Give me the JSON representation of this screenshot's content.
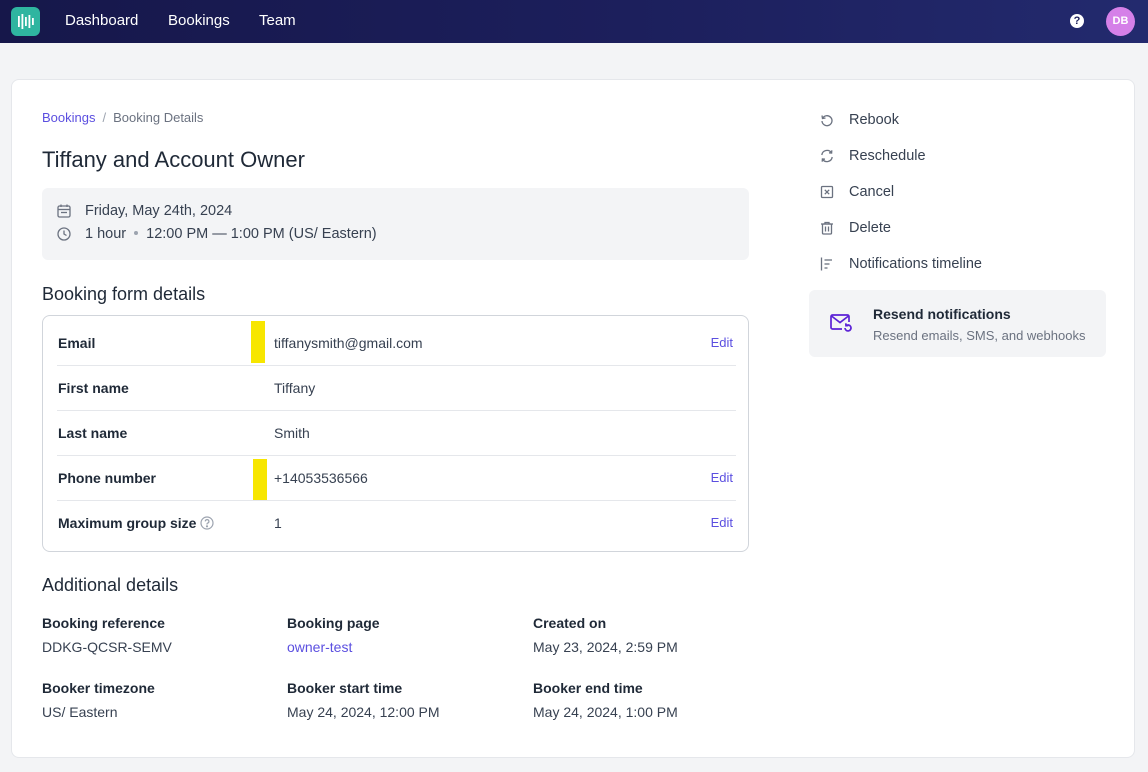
{
  "nav": {
    "items": [
      "Dashboard",
      "Bookings",
      "Team"
    ],
    "help_label": "?",
    "avatar_initials": "DB",
    "brand_color": "#2fb5a0"
  },
  "breadcrumb": {
    "parent": "Bookings",
    "separator": "/",
    "current": "Booking Details"
  },
  "booking": {
    "title": "Tiffany and Account Owner",
    "date": "Friday, May 24th, 2024",
    "duration": "1 hour",
    "time_range": "12:00 PM — 1:00 PM (US/ Eastern)"
  },
  "form_details": {
    "heading": "Booking form details",
    "edit_label": "Edit",
    "rows": [
      {
        "label": "Email",
        "value": "tiffanysmith@gmail.com",
        "editable": true
      },
      {
        "label": "First name",
        "value": "Tiffany",
        "editable": false
      },
      {
        "label": "Last name",
        "value": "Smith",
        "editable": false
      },
      {
        "label": "Phone number",
        "value": "+14053536566",
        "editable": true
      },
      {
        "label": "Maximum group size",
        "value": "1",
        "editable": true
      }
    ]
  },
  "additional": {
    "heading": "Additional details",
    "items": [
      {
        "label": "Booking reference",
        "value": "DDKG-QCSR-SEMV"
      },
      {
        "label": "Booking page",
        "value": "owner-test"
      },
      {
        "label": "Created on",
        "value": "May 23, 2024, 2:59 PM"
      },
      {
        "label": "Booker timezone",
        "value": "US/ Eastern"
      },
      {
        "label": "Booker start time",
        "value": "May 24, 2024, 12:00 PM"
      },
      {
        "label": "Booker end time",
        "value": "May 24, 2024, 1:00 PM"
      }
    ]
  },
  "actions": {
    "items": [
      {
        "label": "Rebook",
        "icon": "rebook-icon"
      },
      {
        "label": "Reschedule",
        "icon": "reschedule-icon"
      },
      {
        "label": "Cancel",
        "icon": "cancel-icon"
      },
      {
        "label": "Delete",
        "icon": "trash-icon"
      },
      {
        "label": "Notifications timeline",
        "icon": "timeline-icon"
      }
    ],
    "resend": {
      "title": "Resend notifications",
      "subtitle": "Resend emails, SMS, and webhooks",
      "icon": "mail-refresh-icon"
    }
  },
  "colors": {
    "accent": "#5b4fe0",
    "highlight": "#f7e600",
    "nav_bg": "#1c1f5c",
    "avatar_bg": "#d580e8"
  }
}
